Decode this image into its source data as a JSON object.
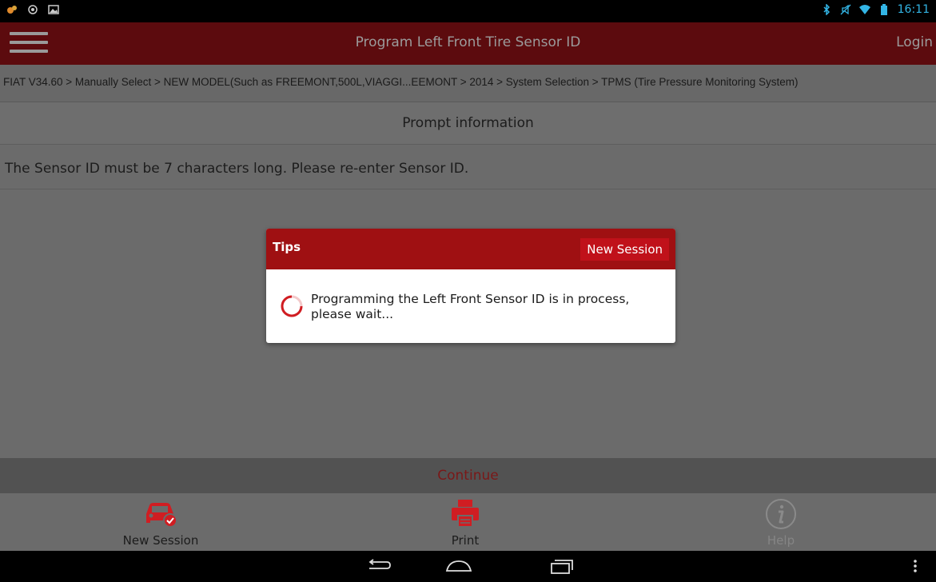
{
  "status_bar": {
    "left_icons": [
      "notification-app-icon",
      "location-icon",
      "image-icon"
    ],
    "right_icons": [
      "bluetooth-icon",
      "mute-icon",
      "wifi-icon",
      "battery-icon"
    ],
    "time": "16:11"
  },
  "app_bar": {
    "title": "Program Left Front Tire Sensor ID",
    "login_label": "Login"
  },
  "breadcrumb": "FIAT V34.60 > Manually Select > NEW MODEL(Such as FREEMONT,500L,VIAGGI...EEMONT > 2014 > System Selection > TPMS (Tire Pressure Monitoring System)",
  "prompt": {
    "header": "Prompt information",
    "message": "The Sensor ID must be 7 characters long. Please re-enter Sensor ID."
  },
  "continue_label": "Continue",
  "toolbar": {
    "new_session_label": "New Session",
    "print_label": "Print",
    "help_label": "Help"
  },
  "dialog": {
    "title": "Tips",
    "new_session_label": "New Session",
    "message": "Programming the Left Front Sensor ID is in process, please wait..."
  },
  "colors": {
    "app_bar": "#5c0b0e",
    "dialog_header": "#9f1012",
    "dialog_button": "#c0111a",
    "accent_red": "#d01d22",
    "status_blue": "#33b5e5"
  }
}
